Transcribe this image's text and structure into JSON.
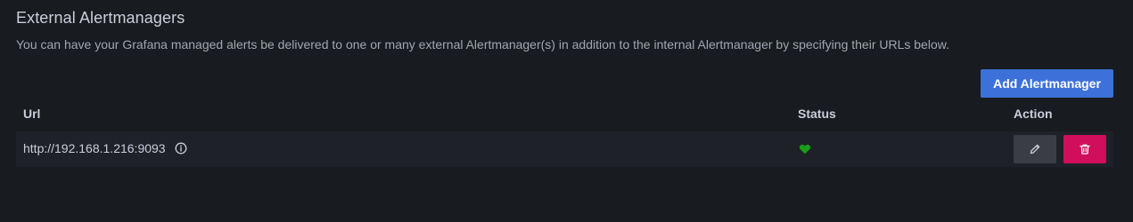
{
  "section": {
    "title": "External Alertmanagers",
    "description": "You can have your Grafana managed alerts be delivered to one or many external Alertmanager(s) in addition to the internal Alertmanager by specifying their URLs below."
  },
  "toolbar": {
    "add_label": "Add Alertmanager"
  },
  "table": {
    "columns": [
      "Url",
      "Status",
      "Action"
    ],
    "rows": [
      {
        "url": "http://192.168.1.216:9093",
        "status": "active",
        "status_icon": "heart-icon",
        "actions": [
          "edit-icon",
          "trash-icon"
        ]
      }
    ]
  },
  "colors": {
    "background": "#181b1f",
    "primary_button": "#3d71d9",
    "row_background": "#1e2127",
    "status_ok": "#1a9e1a",
    "destructive_button": "#d10e5c",
    "secondary_button": "#3a3d44"
  }
}
